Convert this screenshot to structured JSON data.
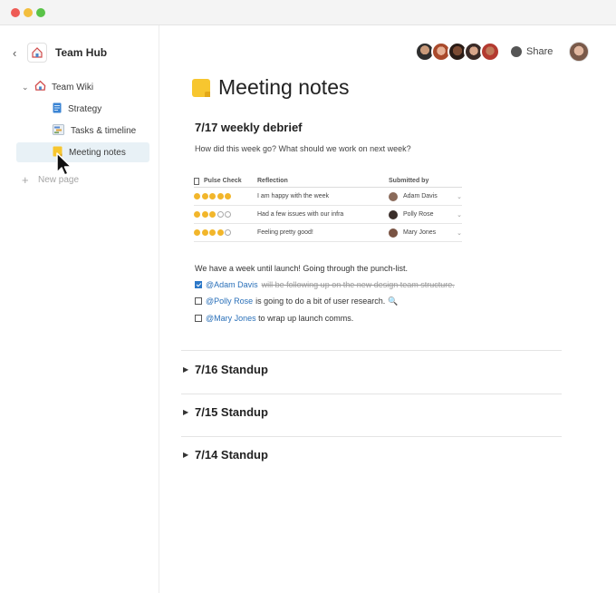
{
  "window": {
    "controls": [
      "close",
      "minimize",
      "zoom"
    ]
  },
  "sidebar": {
    "hub_title": "Team Hub",
    "wiki_label": "Team Wiki",
    "items": [
      {
        "label": "Strategy",
        "icon": "doc-icon"
      },
      {
        "label": "Tasks & timeline",
        "icon": "timeline-icon"
      },
      {
        "label": "Meeting notes",
        "icon": "note-icon",
        "active": true
      }
    ],
    "new_page_label": "New page"
  },
  "topbar": {
    "share_label": "Share",
    "collaborator_count": 5,
    "colors": {
      "accent": "#2a70b9",
      "active_bg": "#e8f1f6"
    }
  },
  "doc": {
    "title": "Meeting notes",
    "heading": "7/17 weekly debrief",
    "question": "How did this week go? What should we work on next week?",
    "table": {
      "headers": [
        "Pulse Check",
        "Reflection",
        "Submitted by"
      ],
      "rows": [
        {
          "pulse": 5,
          "reflection": "I am happy with the week",
          "submitted_by": "Adam Davis"
        },
        {
          "pulse": 3,
          "reflection": "Had a few issues with our infra",
          "submitted_by": "Polly Rose"
        },
        {
          "pulse": 4,
          "reflection": "Feeling pretty good!",
          "submitted_by": "Mary Jones"
        }
      ]
    },
    "intro": "We have a week until launch! Going through the punch-list.",
    "todos": [
      {
        "checked": true,
        "mention": "@Adam Davis",
        "text": "will be following up on the new design team structure."
      },
      {
        "checked": false,
        "mention": "@Polly Rose",
        "text": "is going to do a bit of user research."
      },
      {
        "checked": false,
        "mention": "@Mary Jones",
        "text": " to wrap up launch comms."
      }
    ],
    "sections": [
      "7/16 Standup",
      "7/15 Standup",
      "7/14 Standup"
    ]
  }
}
